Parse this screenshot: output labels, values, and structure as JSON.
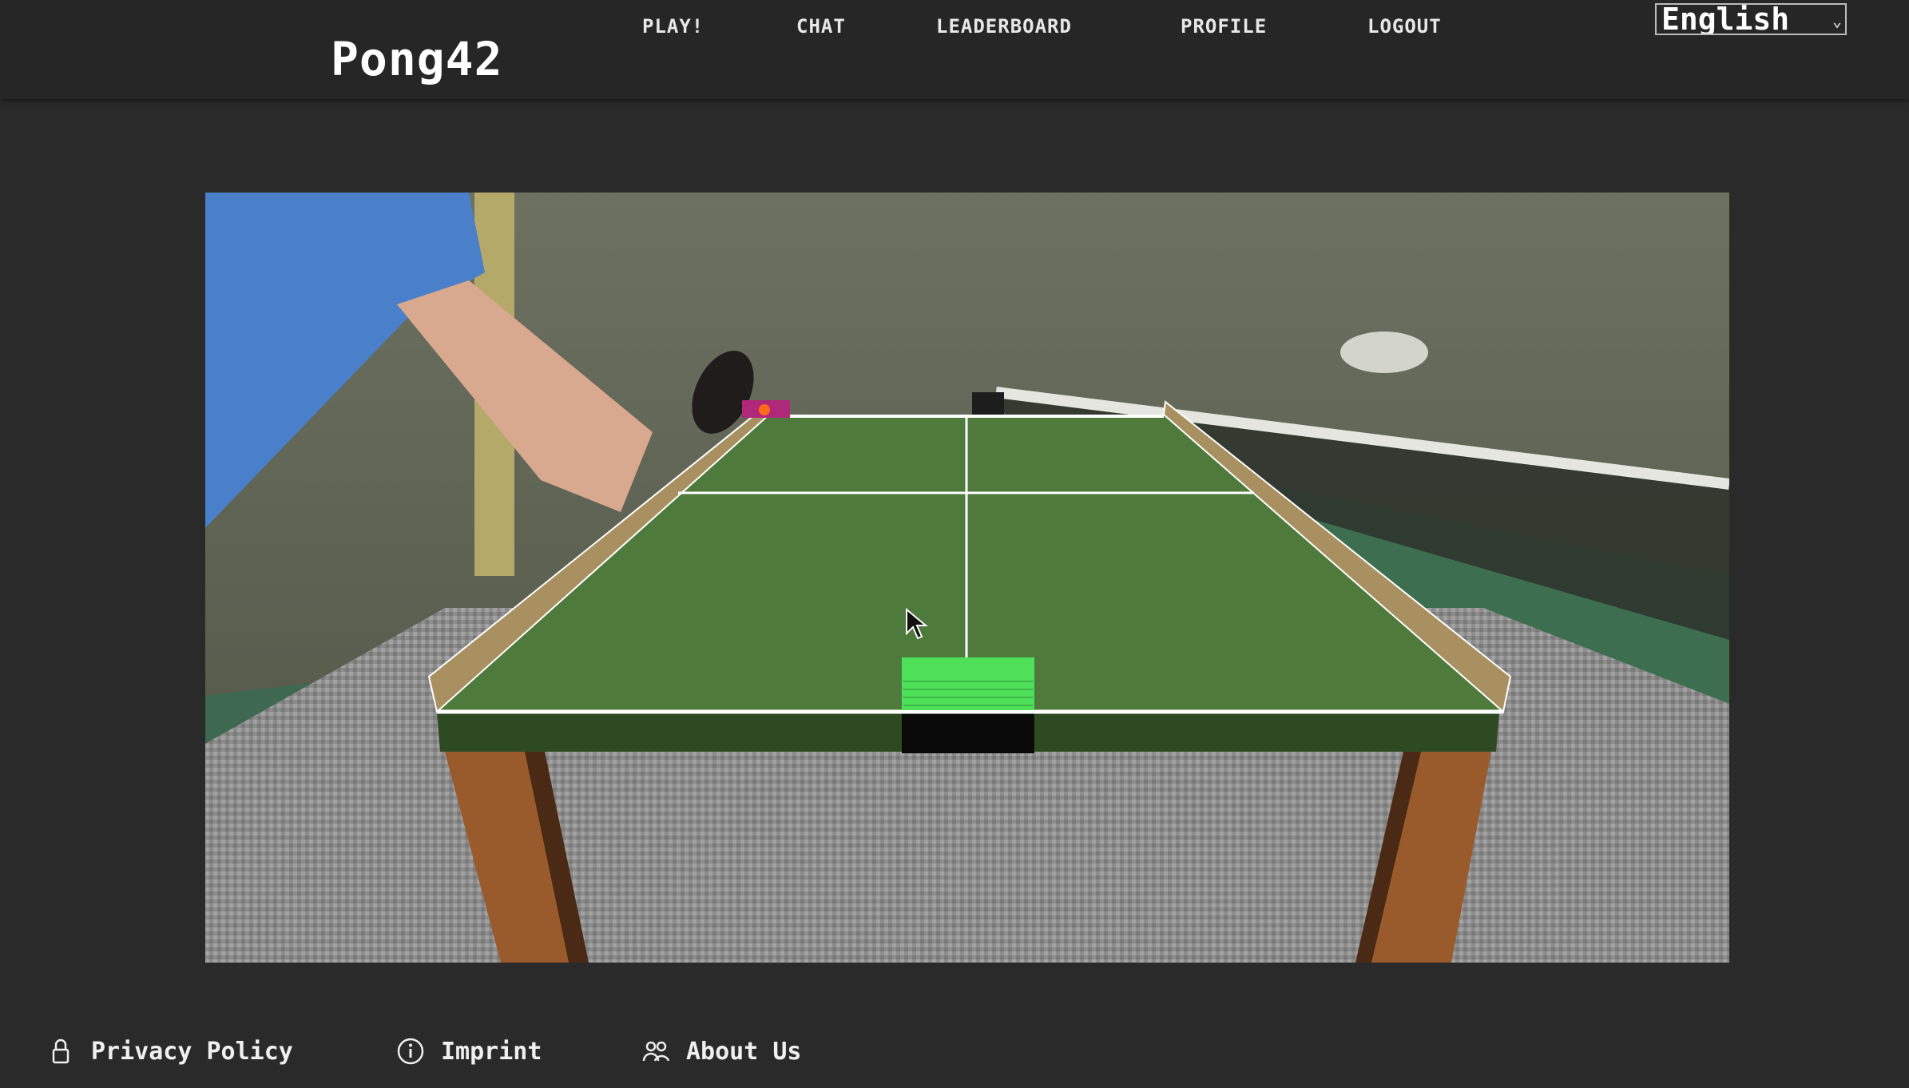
{
  "app": {
    "brand": "Pong42"
  },
  "nav": {
    "items": [
      {
        "label": "PLAY!"
      },
      {
        "label": "CHAT"
      },
      {
        "label": "LEADERBOARD"
      },
      {
        "label": "PROFILE"
      },
      {
        "label": "LOGOUT"
      }
    ],
    "language": {
      "selected": "English",
      "icon": "chevron-down-icon"
    }
  },
  "game": {
    "scene": "3d-pong-table",
    "colors": {
      "table": "#4e7a3b",
      "line": "#ffffff",
      "player_paddle": "#4fe05a",
      "opponent_paddle": "#b0287a",
      "ball": "#ff6a1a",
      "wall": "#a89060",
      "leg": "#9a5b2c"
    }
  },
  "footer": {
    "links": [
      {
        "label": "Privacy Policy",
        "icon": "lock-icon"
      },
      {
        "label": "Imprint",
        "icon": "info-icon"
      },
      {
        "label": "About Us",
        "icon": "people-icon"
      }
    ]
  }
}
